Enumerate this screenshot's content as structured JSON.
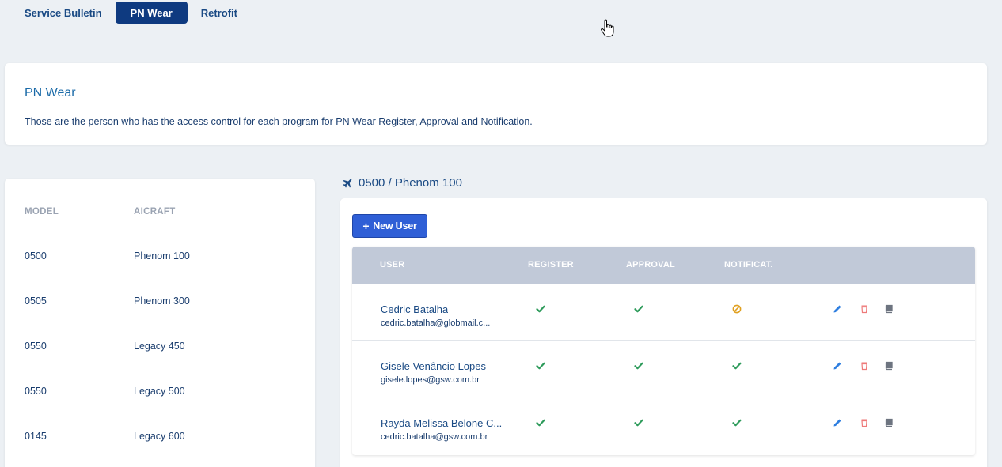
{
  "tabs": [
    {
      "label": "Service Bulletin",
      "active": false
    },
    {
      "label": "PN Wear",
      "active": true
    },
    {
      "label": "Retrofit",
      "active": false
    }
  ],
  "info": {
    "title": "PN Wear",
    "description": "Those are the person who has the access control for each program for PN Wear Register, Approval and Notification."
  },
  "models": {
    "headers": {
      "model": "MODEL",
      "aircraft": "AICRAFT"
    },
    "rows": [
      {
        "model": "0500",
        "aircraft": "Phenom 100"
      },
      {
        "model": "0505",
        "aircraft": "Phenom 300"
      },
      {
        "model": "0550",
        "aircraft": "Legacy 450"
      },
      {
        "model": "0550",
        "aircraft": "Legacy 500"
      },
      {
        "model": "0145",
        "aircraft": "Legacy 600"
      }
    ]
  },
  "selected": {
    "heading": "0500 / Phenom 100",
    "icon": "plane-icon"
  },
  "users": {
    "new_user_label": "New User",
    "headers": {
      "user": "USER",
      "register": "REGISTER",
      "approval": "APPROVAL",
      "notification": "NOTIFICAT."
    },
    "rows": [
      {
        "name": "Cedric Batalha",
        "email": "cedric.batalha@globmail.c...",
        "register": "check",
        "approval": "check",
        "notification": "blocked"
      },
      {
        "name": "Gisele Venâncio Lopes",
        "email": "gisele.lopes@gsw.com.br",
        "register": "check",
        "approval": "check",
        "notification": "check"
      },
      {
        "name": "Rayda Melissa Belone C...",
        "email": "cedric.batalha@gsw.com.br",
        "register": "check",
        "approval": "check",
        "notification": "check"
      }
    ]
  },
  "colors": {
    "accent": "#0e3a80",
    "button": "#2f5fd6",
    "check": "#2e9b5b",
    "blocked": "#e0a020",
    "edit": "#2f7fe0",
    "delete": "#ee7a7a",
    "log": "#6d7480"
  }
}
